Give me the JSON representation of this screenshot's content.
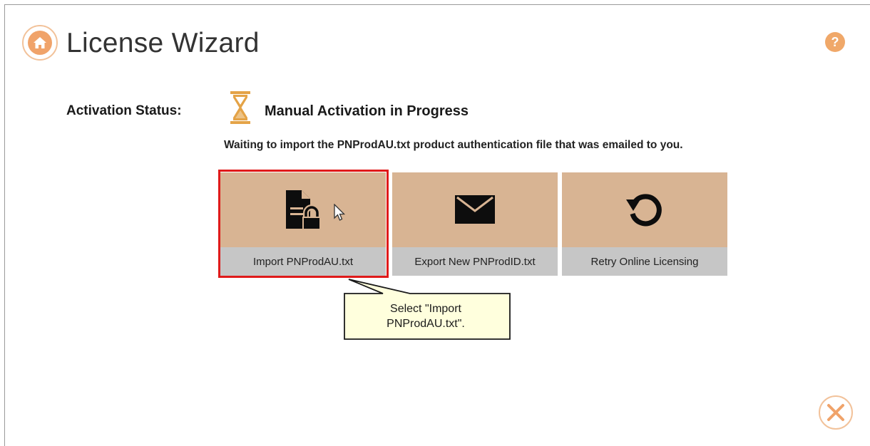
{
  "header": {
    "title": "License Wizard",
    "home_icon": "home-icon",
    "help_icon": "help-icon",
    "help_glyph": "?"
  },
  "status": {
    "label": "Activation Status:",
    "icon": "hourglass-icon",
    "value": "Manual Activation in Progress",
    "message": "Waiting to import the PNProdAU.txt product authentication file that was emailed to you."
  },
  "tiles": [
    {
      "label": "Import PNProdAU.txt",
      "icon": "file-lock-icon"
    },
    {
      "label": "Export New PNProdID.txt",
      "icon": "envelope-icon"
    },
    {
      "label": "Retry Online Licensing",
      "icon": "retry-icon"
    }
  ],
  "callout": {
    "line1": "Select \"Import",
    "line2": "PNProdAU.txt\"."
  },
  "footer": {
    "close_icon": "close-icon"
  },
  "colors": {
    "accent": "#f0a36a",
    "tile_bg": "#d8b493",
    "tile_label_bg": "#c6c6c6",
    "highlight": "#e01a1a",
    "callout_bg": "#ffffdd"
  }
}
